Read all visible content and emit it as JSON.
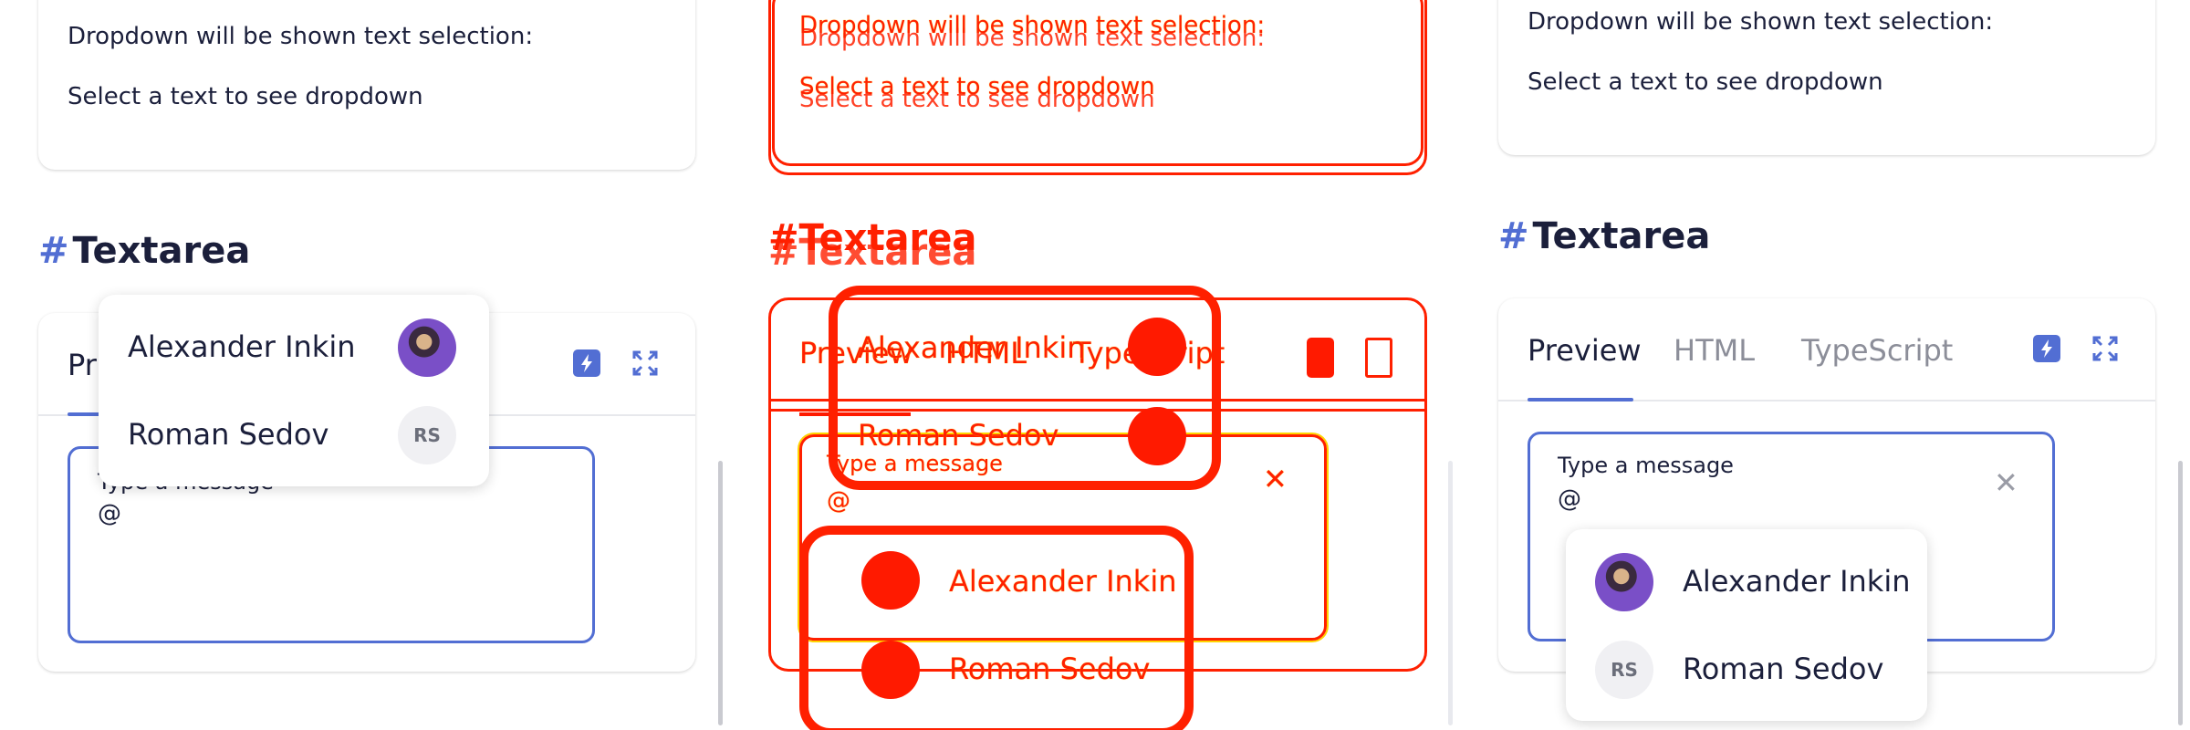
{
  "demo": {
    "card_line1": "Dropdown will be shown text selection:",
    "card_line2": "Select a text to see dropdown"
  },
  "section": {
    "hash": "#",
    "title": "Textarea"
  },
  "tabs": [
    {
      "label": "Preview"
    },
    {
      "label": "HTML"
    },
    {
      "label": "TypeScript"
    }
  ],
  "left_tab_partial": "Pr",
  "textarea": {
    "label": "Type a message",
    "value": "@",
    "clear_icon": "close-icon"
  },
  "mentions": [
    {
      "name": "Alexander Inkin",
      "initials": "",
      "avatar": "photo"
    },
    {
      "name": "Roman Sedov",
      "initials": "RS",
      "avatar": "initials"
    }
  ],
  "icons": {
    "bolt": "bolt-icon",
    "expand": "expand-icon"
  },
  "colors": {
    "accent": "#526ed3",
    "text": "#1b1f3b",
    "muted": "#8c8e99",
    "diff_red": "#ff2000",
    "diff_yellow": "#ffd400"
  }
}
